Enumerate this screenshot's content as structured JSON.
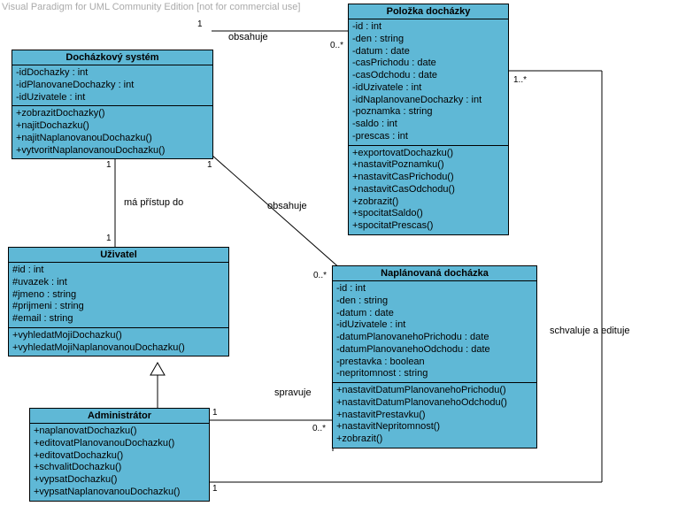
{
  "watermark": "Visual Paradigm for UML Community Edition [not for commercial use]",
  "classes": [
    {
      "name": "Docházkový systém",
      "attributes": [
        "-idDochazky : int",
        "-idPlanovaneDochazky : int",
        "-idUzivatele : int"
      ],
      "methods": [
        "+zobrazitDochazky()",
        "+najitDochazku()",
        "+najitNaplanovanouDochazku()",
        "+vytvoritNaplanovanouDochazku()"
      ]
    },
    {
      "name": "Položka docházky",
      "attributes": [
        "-id : int",
        "-den : string",
        "-datum : date",
        "-casPrichodu : date",
        "-casOdchodu : date",
        "-idUzivatele : int",
        "-idNaplanovaneDochazky : int",
        "-poznamka : string",
        "-saldo : int",
        "-prescas : int"
      ],
      "methods": [
        "+exportovatDochazku()",
        "+nastavitPoznamku()",
        "+nastavitCasPrichodu()",
        "+nastavitCasOdchodu()",
        "+zobrazit()",
        "+spocitatSaldo()",
        "+spocitatPrescas()"
      ]
    },
    {
      "name": "Uživatel",
      "attributes": [
        "#id : int",
        "#uvazek : int",
        "#jmeno : string",
        "#prijmeni : string",
        "#email : string"
      ],
      "methods": [
        "+vyhledatMojiDochazku()",
        "+vyhledatMojiNaplanovanouDochazku()"
      ]
    },
    {
      "name": "Naplánovaná docházka",
      "attributes": [
        "-id : int",
        "-den : string",
        "-datum : date",
        "-idUzivatele : int",
        "-datumPlanovanehoPrichodu : date",
        "-datumPlanovanehoOdchodu : date",
        "-prestavka : boolean",
        "-nepritomnost : string"
      ],
      "methods": [
        "+nastavitDatumPlanovanehoPrichodu()",
        "+nastavitDatumPlanovanehoOdchodu()",
        "+nastavitPrestavku()",
        "+nastavitNepritomnost()",
        "+zobrazit()"
      ]
    },
    {
      "name": "Administrátor",
      "attributes": [],
      "methods": [
        "+naplanovatDochazku()",
        "+editovatPlanovanouDochazku()",
        "+editovatDochazku()",
        "+schvalitDochazku()",
        "+vypsatDochazku()",
        "+vypsatNaplanovanouDochazku()"
      ]
    }
  ],
  "relations": [
    {
      "label": "obsahuje",
      "multA": "1",
      "multB": "0..*"
    },
    {
      "label": "má přístup do",
      "multA": "1",
      "multB": "1"
    },
    {
      "label": "obsahuje",
      "multA": "1",
      "multB": "0..*"
    },
    {
      "label": "spravuje",
      "multA": "1",
      "multB": "0..*"
    },
    {
      "label": "schvaluje a edituje",
      "multA": "1",
      "multB": "1..*"
    }
  ]
}
